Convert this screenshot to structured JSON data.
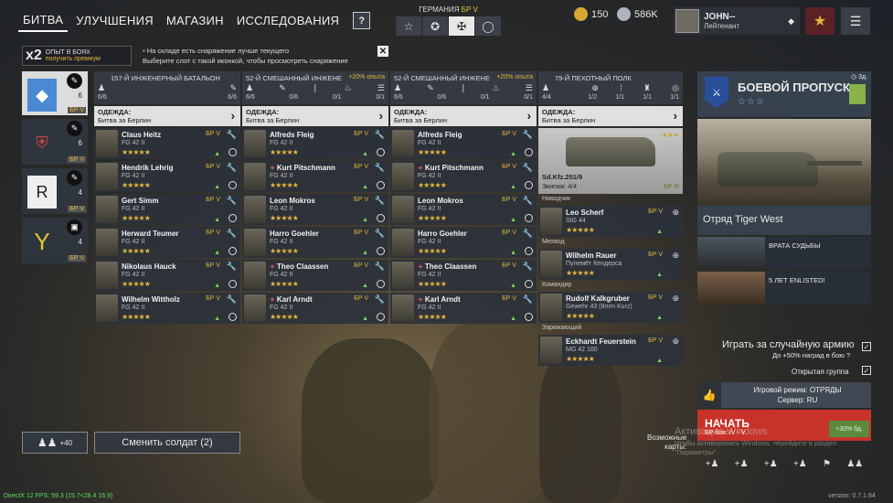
{
  "nav": {
    "tabs": [
      "БИТВА",
      "УЛУЧШЕНИЯ",
      "МАГАЗИН",
      "ИССЛЕДОВАНИЯ"
    ],
    "help": "?"
  },
  "nation": {
    "label": "ГЕРМАНИЯ",
    "br": "БР V"
  },
  "currency": {
    "gold": "150",
    "silver": "586K"
  },
  "player": {
    "name": "JOHN--",
    "rank": "Лейтенант"
  },
  "xp_banner": {
    "multiplier": "x2",
    "line1": "ОПЫТ В БОЯХ",
    "line2": "получить премиум"
  },
  "notice": {
    "line1": "На складе есть снаряжение лучше текущего",
    "line2": "Выберите слот с такой иконкой, чтобы просмотреть снаряжение"
  },
  "squad_icons": [
    {
      "count": "6",
      "br": "БР V"
    },
    {
      "count": "6",
      "br": "БР V"
    },
    {
      "count": "4",
      "br": "БР V"
    },
    {
      "count": "4",
      "br": "БР V"
    }
  ],
  "outfit_label": "ОДЕЖДА:",
  "outfit_value": "Битва за Берлин",
  "squads": [
    {
      "name": "157-Й ИНЖЕНЕРНЫЙ БАТАЛЬОН",
      "bonus": "",
      "nums": [
        "6/6",
        "6/6"
      ],
      "soldiers": [
        {
          "name": "Claus Heitz",
          "weapon": "FG 42 II",
          "br": "БР V"
        },
        {
          "name": "Hendrik Lehrig",
          "weapon": "FG 42 II",
          "br": "БР V"
        },
        {
          "name": "Gert Simm",
          "weapon": "FG 42 II",
          "br": "БР V"
        },
        {
          "name": "Herward Teumer",
          "weapon": "FG 42 II",
          "br": "БР V"
        },
        {
          "name": "Nikolaus Hauck",
          "weapon": "FG 42 II",
          "br": "БР V"
        },
        {
          "name": "Wilhelm Wittholz",
          "weapon": "FG 42 II",
          "br": "БР V"
        }
      ]
    },
    {
      "name": "52-Й СМЕШАННЫЙ ИНЖЕНЕ",
      "bonus": "+20% опыта",
      "nums": [
        "6/6",
        "0/6",
        "0/1",
        "0/1"
      ],
      "soldiers": [
        {
          "name": "Alfreds Fleig",
          "weapon": "FG 42 II",
          "br": "БР V"
        },
        {
          "name": "Kurt Pitschmann",
          "weapon": "FG 42 II",
          "br": "БР V"
        },
        {
          "name": "Leon Mokros",
          "weapon": "FG 42 II",
          "br": "БР V"
        },
        {
          "name": "Harro Goehler",
          "weapon": "FG 42 II",
          "br": "БР V"
        },
        {
          "name": "Theo Claassen",
          "weapon": "FG 42 II",
          "br": "БР V"
        },
        {
          "name": "Karl Arndt",
          "weapon": "FG 42 II",
          "br": "БР V"
        }
      ]
    },
    {
      "name": "52-Й СМЕШАННЫЙ ИНЖЕНЕ",
      "bonus": "+20% опыта",
      "nums": [
        "6/6",
        "0/6",
        "0/1",
        "0/1"
      ],
      "soldiers": [
        {
          "name": "Alfreds Fleig",
          "weapon": "FG 42 II",
          "br": "БР V"
        },
        {
          "name": "Kurt Pitschmann",
          "weapon": "FG 42 II",
          "br": "БР V"
        },
        {
          "name": "Leon Mokros",
          "weapon": "FG 42 II",
          "br": "БР V"
        },
        {
          "name": "Harro Goehler",
          "weapon": "FG 42 II",
          "br": "БР V"
        },
        {
          "name": "Theo Claassen",
          "weapon": "FG 42 II",
          "br": "БР V"
        },
        {
          "name": "Karl Arndt",
          "weapon": "FG 42 II",
          "br": "БР V"
        }
      ]
    }
  ],
  "vehicle_squad": {
    "name": "79-Й ПЕХОТНЫЙ ПОЛК",
    "nums": [
      "4/4",
      "1/2",
      "1/1",
      "1/1",
      "1/1"
    ],
    "vehicle": {
      "name": "Sd.Kfz.251/9",
      "crew": "Экипаж: 4/4",
      "br": "БР III"
    },
    "crew": [
      {
        "role": "Наводчик",
        "name": "Leo Scherf",
        "weapon": "StG 44",
        "br": "БР V"
      },
      {
        "role": "Мехвод",
        "name": "Wilhelm Rauer",
        "weapon": "Пулемёт Кендерса",
        "br": "БР V"
      },
      {
        "role": "Командир",
        "name": "Rudolf Kalkgruber",
        "weapon": "Gewehr 43 (8mm Kurz)",
        "br": "БР V"
      },
      {
        "role": "Заряжающий",
        "name": "Eckhardt Feuerstein",
        "weapon": "MG 42 100",
        "br": "БР V"
      }
    ]
  },
  "battle_pass": {
    "title": "БОЕВОЙ ПРОПУСК",
    "stars": "☆☆☆",
    "timer": "3д.",
    "reward_title": "Отряд Tiger West",
    "events": [
      "ВРАТА СУДЬБЫ",
      "5 ЛЕТ ENLISTED!"
    ]
  },
  "options": {
    "random_army": "Играть за случайную армию",
    "random_army_sub": "До +50% наград в бою",
    "open_group": "Открытая группа"
  },
  "mode": {
    "line1": "Игровой режим: ОТРЯДЫ",
    "line2": "Сервер: RU"
  },
  "start": {
    "label": "НАЧАТЬ",
    "sub": "БР боя: IV - V",
    "xp": "+30% бд."
  },
  "maps": {
    "line1": "Возможные",
    "line2": "карты:"
  },
  "watermark": {
    "line1": "Активация Windows",
    "line2": "Чтобы активировать Windows, перейдите в раздел \"Параметры\"."
  },
  "bottom": {
    "group_count": "+40",
    "change_soldier": "Сменить солдат (2)"
  },
  "fps": "DirectX 12 FPS: 59.3 (15.7<28.4 16.9)",
  "version": "version: 0.7.1.64"
}
